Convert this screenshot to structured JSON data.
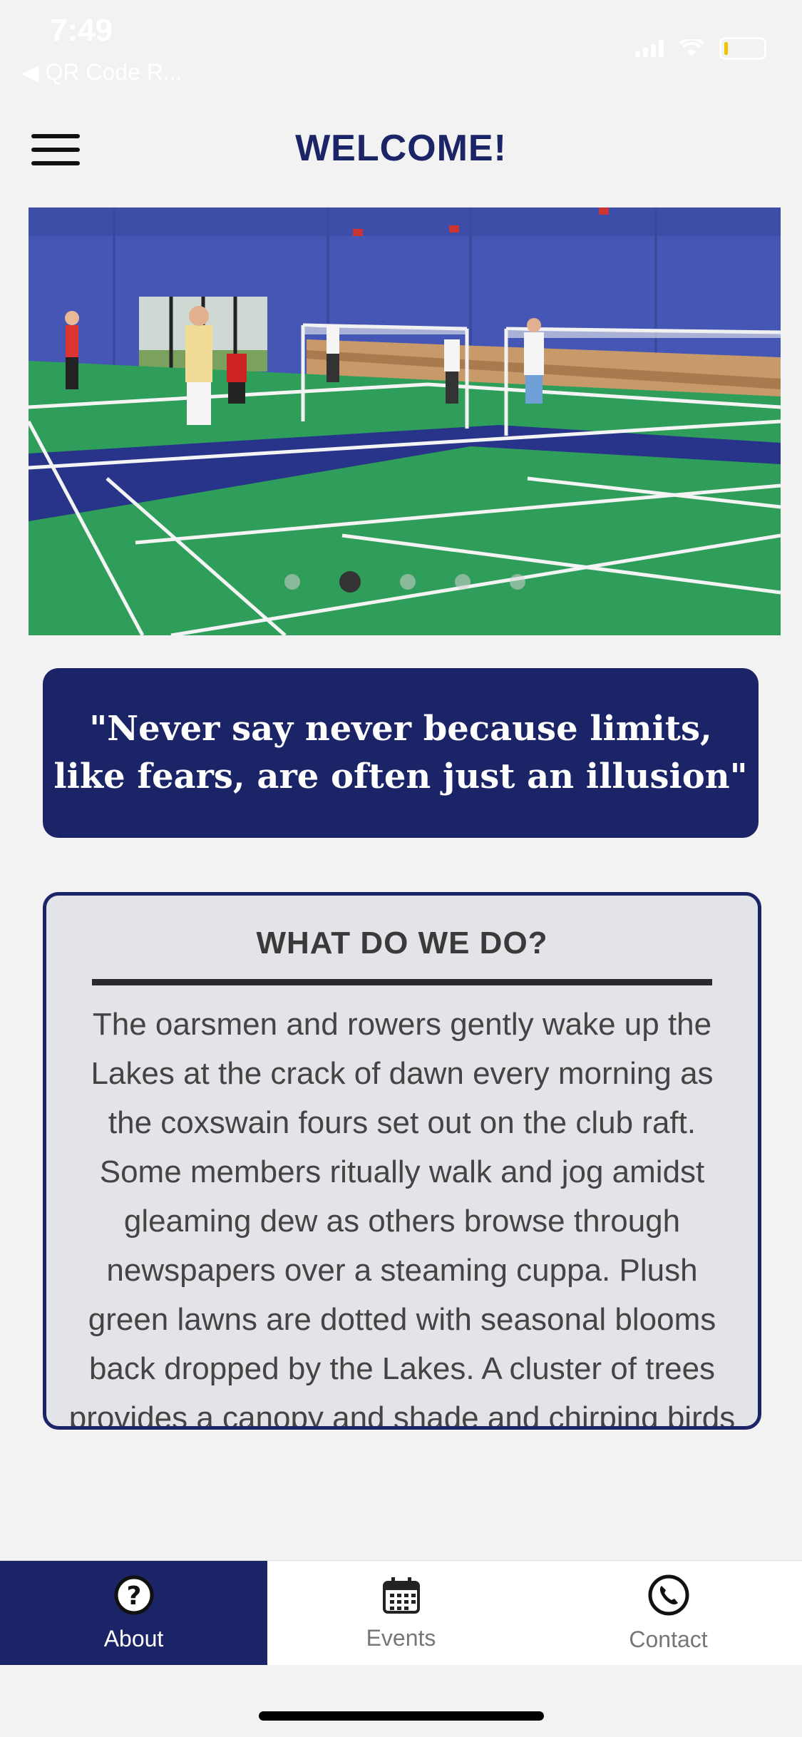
{
  "status": {
    "time": "7:49",
    "back_label": "◀ QR Code R..."
  },
  "header": {
    "title": "WELCOME!"
  },
  "carousel": {
    "slide_count": 5,
    "active_index": 1
  },
  "quote": {
    "text": "\"Never say never because limits, like fears, are often just an illusion\""
  },
  "info": {
    "title": "WHAT DO WE DO?",
    "body": "The oarsmen and rowers gently wake up the Lakes at the crack of dawn every morning as the coxswain fours set out on the club raft. Some members ritually walk and jog amidst gleaming dew as others browse through newspapers over a steaming cuppa. Plush green lawns are dotted with seasonal blooms back dropped by the Lakes. A cluster of trees provides a canopy and shade and chirping birds"
  },
  "tabs": [
    {
      "label": "About",
      "icon": "question-icon",
      "active": true
    },
    {
      "label": "Events",
      "icon": "calendar-icon",
      "active": false
    },
    {
      "label": "Contact",
      "icon": "phone-icon",
      "active": false
    }
  ],
  "colors": {
    "navy": "#1a2466",
    "court_green": "#2f9e5a",
    "wall_blue": "#4556b5"
  }
}
